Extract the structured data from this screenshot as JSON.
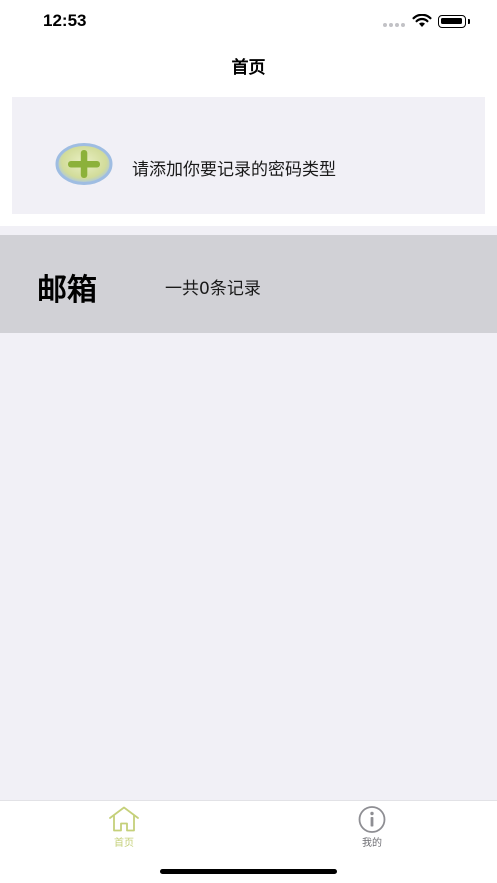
{
  "status_bar": {
    "time": "12:53"
  },
  "nav": {
    "title": "首页"
  },
  "add_card": {
    "icon": "plus-circle-icon",
    "label": "请添加你要记录的密码类型"
  },
  "categories": [
    {
      "name": "邮箱",
      "count_text": "一共0条记录"
    }
  ],
  "tab_bar": {
    "tabs": [
      {
        "label": "首页",
        "icon": "home-icon",
        "selected": true
      },
      {
        "label": "我的",
        "icon": "info-icon",
        "selected": false
      }
    ]
  },
  "colors": {
    "accent": "#c5d07a",
    "background": "#f1f0f6",
    "row_background": "#d1d1d6"
  }
}
